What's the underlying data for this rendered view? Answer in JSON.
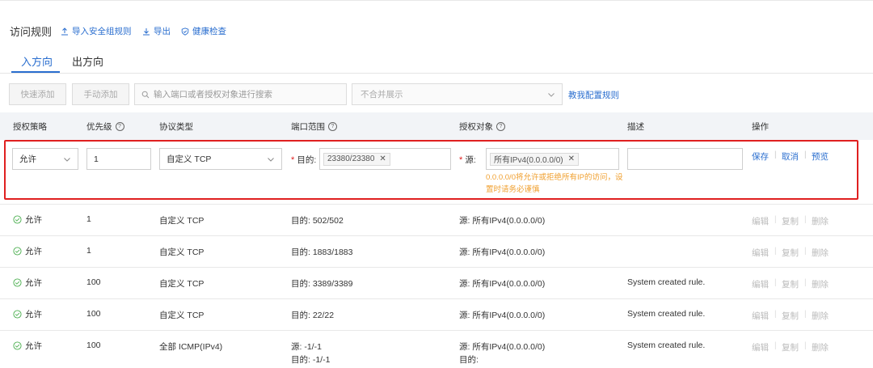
{
  "header": {
    "title": "访问规则",
    "links": [
      {
        "label": "导入安全组规则",
        "icon": "upload-icon"
      },
      {
        "label": "导出",
        "icon": "download-icon"
      },
      {
        "label": "健康检查",
        "icon": "shield-check-icon"
      }
    ]
  },
  "tabs": [
    {
      "label": "入方向",
      "active": true
    },
    {
      "label": "出方向",
      "active": false
    }
  ],
  "toolbar": {
    "quick_add": "快速添加",
    "manual_add": "手动添加",
    "search_placeholder": "输入端口或者授权对象进行搜索",
    "merge_select": "不合并展示",
    "help_link": "教我配置规则"
  },
  "columns": [
    "授权策略",
    "优先级",
    "协议类型",
    "端口范围",
    "授权对象",
    "描述",
    "操作"
  ],
  "edit_row": {
    "policy": "允许",
    "priority": "1",
    "protocol": "自定义 TCP",
    "port_label": "目的:",
    "port_tag": "23380/23380",
    "source_label": "源:",
    "source_tag": "所有IPv4(0.0.0.0/0)",
    "description": "",
    "warning": "0.0.0.0/0将允许或拒绝所有IP的访问，设置时请务必谨慎",
    "actions": [
      "保存",
      "取消",
      "预览"
    ]
  },
  "rows": [
    {
      "policy": "允许",
      "priority": "1",
      "protocol": "自定义 TCP",
      "port": "目的: 502/502",
      "port2": "",
      "source": "源: 所有IPv4(0.0.0.0/0)",
      "source2": "",
      "desc": ""
    },
    {
      "policy": "允许",
      "priority": "1",
      "protocol": "自定义 TCP",
      "port": "目的: 1883/1883",
      "port2": "",
      "source": "源: 所有IPv4(0.0.0.0/0)",
      "source2": "",
      "desc": ""
    },
    {
      "policy": "允许",
      "priority": "100",
      "protocol": "自定义 TCP",
      "port": "目的: 3389/3389",
      "port2": "",
      "source": "源: 所有IPv4(0.0.0.0/0)",
      "source2": "",
      "desc": "System created rule."
    },
    {
      "policy": "允许",
      "priority": "100",
      "protocol": "自定义 TCP",
      "port": "目的: 22/22",
      "port2": "",
      "source": "源: 所有IPv4(0.0.0.0/0)",
      "source2": "",
      "desc": "System created rule."
    },
    {
      "policy": "允许",
      "priority": "100",
      "protocol": "全部 ICMP(IPv4)",
      "port": "源: -1/-1",
      "port2": "目的: -1/-1",
      "source": "源: 所有IPv4(0.0.0.0/0)",
      "source2": "目的:",
      "desc": "System created rule."
    }
  ],
  "row_actions": [
    "编辑",
    "复制",
    "删除"
  ]
}
